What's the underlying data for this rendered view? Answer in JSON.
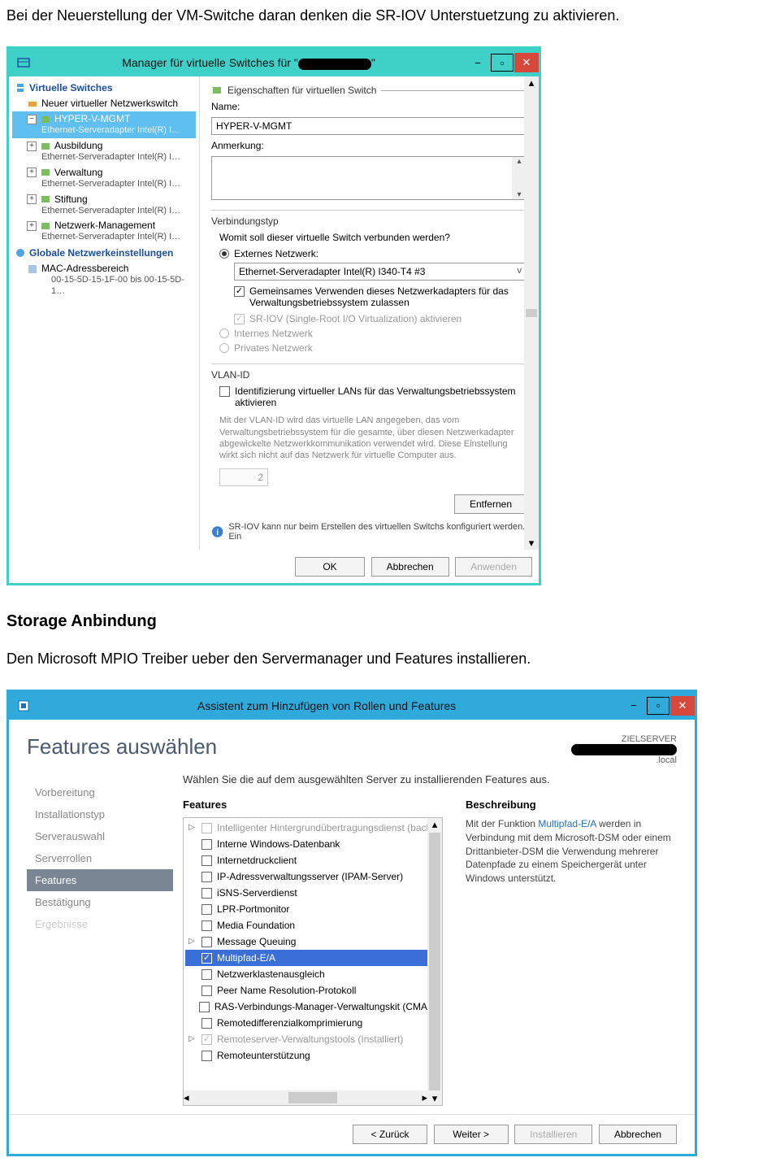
{
  "doc": {
    "intro": "Bei der Neuerstellung der VM-Switche daran denken die SR-IOV Unterstuetzung zu aktivieren.",
    "heading2": "Storage Anbindung",
    "text2": "Den Microsoft MPIO Treiber ueber den Servermanager und Features installieren."
  },
  "win1": {
    "title_prefix": "Manager für virtuelle Switches für \"",
    "title_suffix": "\"",
    "left": {
      "header1": "Virtuelle Switches",
      "new_switch": "Neuer virtueller Netzwerkswitch",
      "items": [
        {
          "name": "HYPER-V-MGMT",
          "sub": "Ethernet-Serveradapter Intel(R) I…",
          "selected": true
        },
        {
          "name": "Ausbildung",
          "sub": "Ethernet-Serveradapter Intel(R) I…"
        },
        {
          "name": "Verwaltung",
          "sub": "Ethernet-Serveradapter Intel(R) I…"
        },
        {
          "name": "Stiftung",
          "sub": "Ethernet-Serveradapter Intel(R) I…"
        },
        {
          "name": "Netzwerk-Management",
          "sub": "Ethernet-Serveradapter Intel(R) I…"
        }
      ],
      "header2": "Globale Netzwerkeinstellungen",
      "mac_label": "MAC-Adressbereich",
      "mac_range": "00-15-5D-15-1F-00 bis 00-15-5D-1…"
    },
    "right": {
      "section": "Eigenschaften für virtuellen Switch",
      "name_label": "Name:",
      "name_value": "HYPER-V-MGMT",
      "note_label": "Anmerkung:",
      "conn_group": "Verbindungstyp",
      "conn_q": "Womit soll dieser virtuelle Switch verbunden werden?",
      "opt_ext": "Externes Netzwerk:",
      "adapter": "Ethernet-Serveradapter Intel(R) I340-T4 #3",
      "chk_share": "Gemeinsames Verwenden dieses Netzwerkadapters für das Verwaltungsbetriebssystem zulassen",
      "chk_sriov": "SR-IOV (Single-Root I/O Virtualization) aktivieren",
      "opt_int": "Internes Netzwerk",
      "opt_priv": "Privates Netzwerk",
      "vlan_group": "VLAN-ID",
      "vlan_chk": "Identifizierung virtueller LANs für das Verwaltungsbetriebssystem aktivieren",
      "vlan_text": "Mit der VLAN-ID wird das virtuelle LAN angegeben, das vom Verwaltungsbetriebssystem für die gesamte, über diesen Netzwerkadapter abgewickelte Netzwerkkommunikation verwendet wird. Diese Einstellung wirkt sich nicht auf das Netzwerk für virtuelle Computer aus.",
      "vlan_value": "2",
      "remove": "Entfernen",
      "info": "SR-IOV kann nur beim Erstellen des virtuellen Switchs konfiguriert werden. Ein",
      "ok": "OK",
      "cancel": "Abbrechen",
      "apply": "Anwenden"
    }
  },
  "win2": {
    "title": "Assistent zum Hinzufügen von Rollen und Features",
    "wiz_title": "Features auswählen",
    "target_label": "ZIELSERVER",
    "target_suffix": ".local",
    "nav": [
      {
        "label": "Vorbereitung"
      },
      {
        "label": "Installationstyp"
      },
      {
        "label": "Serverauswahl"
      },
      {
        "label": "Serverrollen"
      },
      {
        "label": "Features",
        "active": true
      },
      {
        "label": "Bestätigung"
      },
      {
        "label": "Ergebnisse",
        "disabled": true
      }
    ],
    "instr": "Wählen Sie die auf dem ausgewählten Server zu installierenden Features aus.",
    "col1": "Features",
    "col2": "Beschreibung",
    "features": [
      {
        "label": "Intelligenter Hintergrundübertragungsdienst (back",
        "dim": true,
        "exp": true
      },
      {
        "label": "Interne Windows-Datenbank"
      },
      {
        "label": "Internetdruckclient"
      },
      {
        "label": "IP-Adressverwaltungsserver (IPAM-Server)"
      },
      {
        "label": "iSNS-Serverdienst"
      },
      {
        "label": "LPR-Portmonitor"
      },
      {
        "label": "Media Foundation"
      },
      {
        "label": "Message Queuing",
        "exp": true
      },
      {
        "label": "Multipfad-E/A",
        "checked": true,
        "selected": true
      },
      {
        "label": "Netzwerklastenausgleich"
      },
      {
        "label": "Peer Name Resolution-Protokoll"
      },
      {
        "label": "RAS-Verbindungs-Manager-Verwaltungskit (CMAK)"
      },
      {
        "label": "Remotedifferenzialkomprimierung"
      },
      {
        "label": "Remoteserver-Verwaltungstools (Installiert)",
        "checked": true,
        "dim": true,
        "exp": true
      },
      {
        "label": "Remoteunterstützung"
      }
    ],
    "desc_hl": "Multipfad-E/A",
    "desc_rest": " werden in Verbindung mit dem Microsoft-DSM oder einem Drittanbieter-DSM die Verwendung mehrerer Datenpfade zu einem Speichergerät unter Windows unterstützt.",
    "desc_pre": "Mit der Funktion ",
    "back": "< Zurück",
    "next": "Weiter >",
    "install": "Installieren",
    "cancel": "Abbrechen"
  }
}
